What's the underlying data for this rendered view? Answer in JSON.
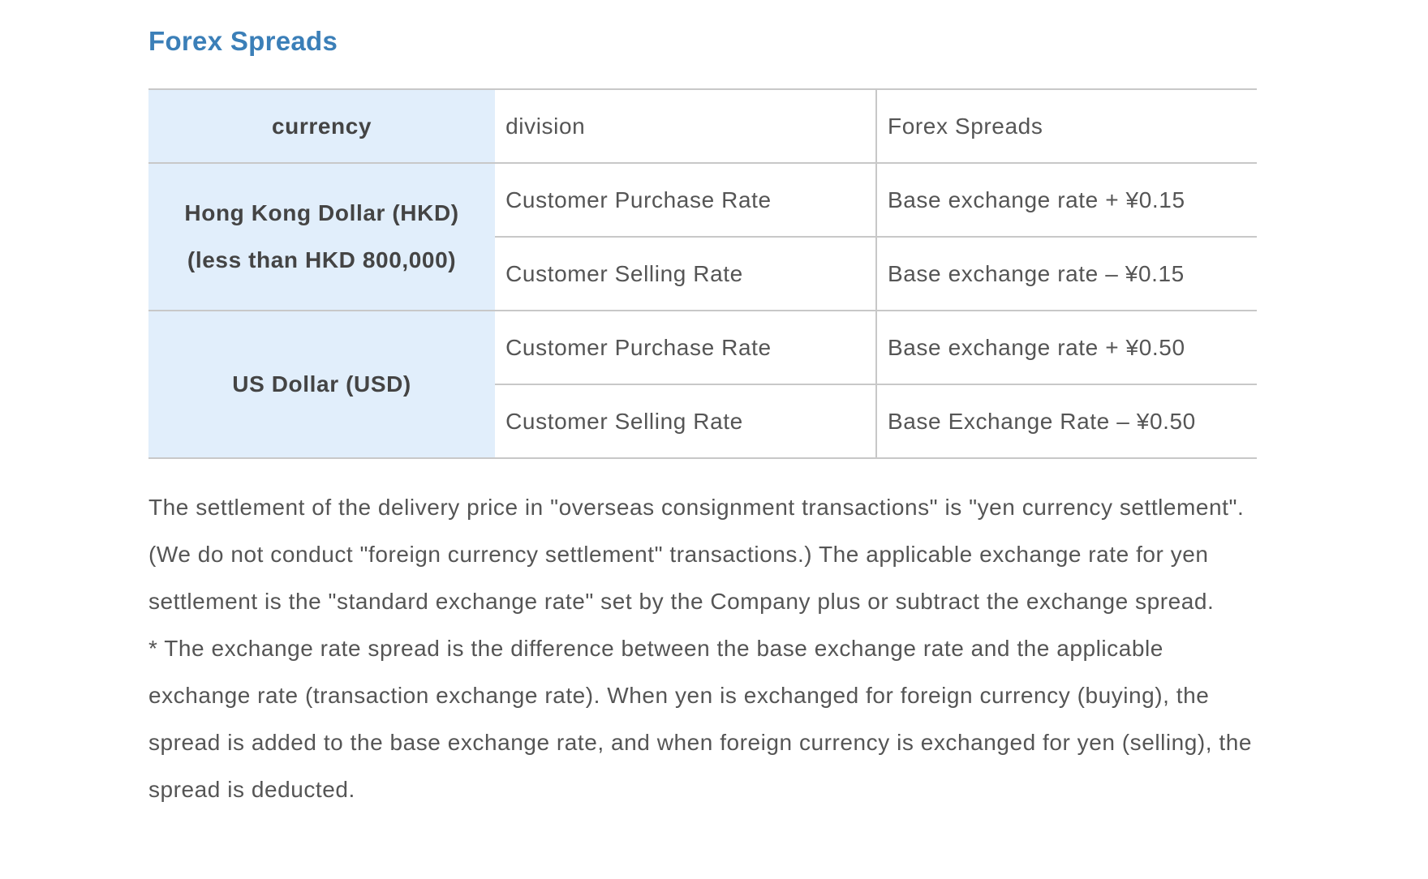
{
  "section": {
    "title": "Forex Spreads"
  },
  "table": {
    "headers": {
      "currency": "currency",
      "division": "division",
      "spread": "Forex Spreads"
    },
    "groups": [
      {
        "currency_line1": "Hong Kong Dollar (HKD)",
        "currency_line2": "(less than HKD 800,000)",
        "rows": [
          {
            "division": "Customer Purchase Rate",
            "spread": "Base exchange rate + ¥0.15"
          },
          {
            "division": "Customer Selling Rate",
            "spread": "Base exchange rate – ¥0.15"
          }
        ]
      },
      {
        "currency_line1": "US Dollar (USD)",
        "rows": [
          {
            "division": "Customer Purchase Rate",
            "spread": "Base exchange rate + ¥0.50"
          },
          {
            "division": "Customer Selling Rate",
            "spread": "Base Exchange Rate – ¥0.50"
          }
        ]
      }
    ]
  },
  "notes": {
    "paragraph1": "The settlement of the delivery price in \"overseas consignment transactions\" is \"yen currency settlement\". (We do not conduct \"foreign currency settlement\" transactions.) The applicable exchange rate for yen settlement is the \"standard exchange rate\" set by the Company plus or subtract the exchange spread.",
    "paragraph2": "* The exchange rate spread is the difference between the base exchange rate and the applicable exchange rate (transaction exchange rate). When yen is exchanged for foreign currency (buying), the spread is added to the base exchange rate, and when foreign currency is exchanged for yen (selling), the spread is deducted."
  }
}
